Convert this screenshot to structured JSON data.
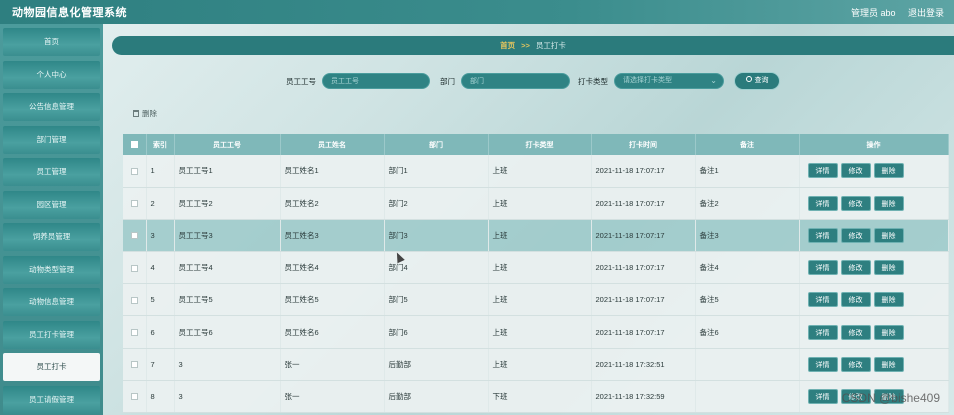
{
  "app": {
    "title": "动物园信息化管理系统",
    "user": "管理员 abo",
    "logout": "退出登录"
  },
  "sidebar": {
    "items": [
      {
        "label": "首页"
      },
      {
        "label": "个人中心"
      },
      {
        "label": "公告信息管理"
      },
      {
        "label": "部门管理"
      },
      {
        "label": "员工管理"
      },
      {
        "label": "园区管理"
      },
      {
        "label": "饲养员管理"
      },
      {
        "label": "动物类型管理"
      },
      {
        "label": "动物信息管理"
      },
      {
        "label": "员工打卡管理"
      },
      {
        "label": "员工打卡",
        "active": true
      },
      {
        "label": "员工请假管理"
      }
    ]
  },
  "breadcrumb": {
    "home": "首页",
    "sep": ">>",
    "current": "员工打卡"
  },
  "search": {
    "emp_no_label": "员工工号",
    "emp_no_placeholder": "员工工号",
    "dept_label": "部门",
    "dept_placeholder": "部门",
    "type_label": "打卡类型",
    "type_placeholder": "请选择打卡类型",
    "query_label": "查询"
  },
  "toolbar": {
    "delete_label": "删除"
  },
  "table": {
    "headers": [
      "索引",
      "员工工号",
      "员工姓名",
      "部门",
      "打卡类型",
      "打卡时间",
      "备注",
      "操作"
    ],
    "rows": [
      {
        "idx": "1",
        "no": "员工工号1",
        "name": "员工姓名1",
        "dept": "部门1",
        "type": "上班",
        "time": "2021-11-18 17:07:17",
        "note": "备注1"
      },
      {
        "idx": "2",
        "no": "员工工号2",
        "name": "员工姓名2",
        "dept": "部门2",
        "type": "上班",
        "time": "2021-11-18 17:07:17",
        "note": "备注2"
      },
      {
        "idx": "3",
        "no": "员工工号3",
        "name": "员工姓名3",
        "dept": "部门3",
        "type": "上班",
        "time": "2021-11-18 17:07:17",
        "note": "备注3"
      },
      {
        "idx": "4",
        "no": "员工工号4",
        "name": "员工姓名4",
        "dept": "部门4",
        "type": "上班",
        "time": "2021-11-18 17:07:17",
        "note": "备注4"
      },
      {
        "idx": "5",
        "no": "员工工号5",
        "name": "员工姓名5",
        "dept": "部门5",
        "type": "上班",
        "time": "2021-11-18 17:07:17",
        "note": "备注5"
      },
      {
        "idx": "6",
        "no": "员工工号6",
        "name": "员工姓名6",
        "dept": "部门6",
        "type": "上班",
        "time": "2021-11-18 17:07:17",
        "note": "备注6"
      },
      {
        "idx": "7",
        "no": "3",
        "name": "张一",
        "dept": "后勤部",
        "type": "上班",
        "time": "2021-11-18 17:32:51",
        "note": ""
      },
      {
        "idx": "8",
        "no": "3",
        "name": "张一",
        "dept": "后勤部",
        "type": "下班",
        "time": "2021-11-18 17:32:59",
        "note": ""
      }
    ],
    "actions": {
      "detail": "详情",
      "edit": "修改",
      "delete": "删除"
    }
  },
  "watermark": "CSDN @bishe409"
}
